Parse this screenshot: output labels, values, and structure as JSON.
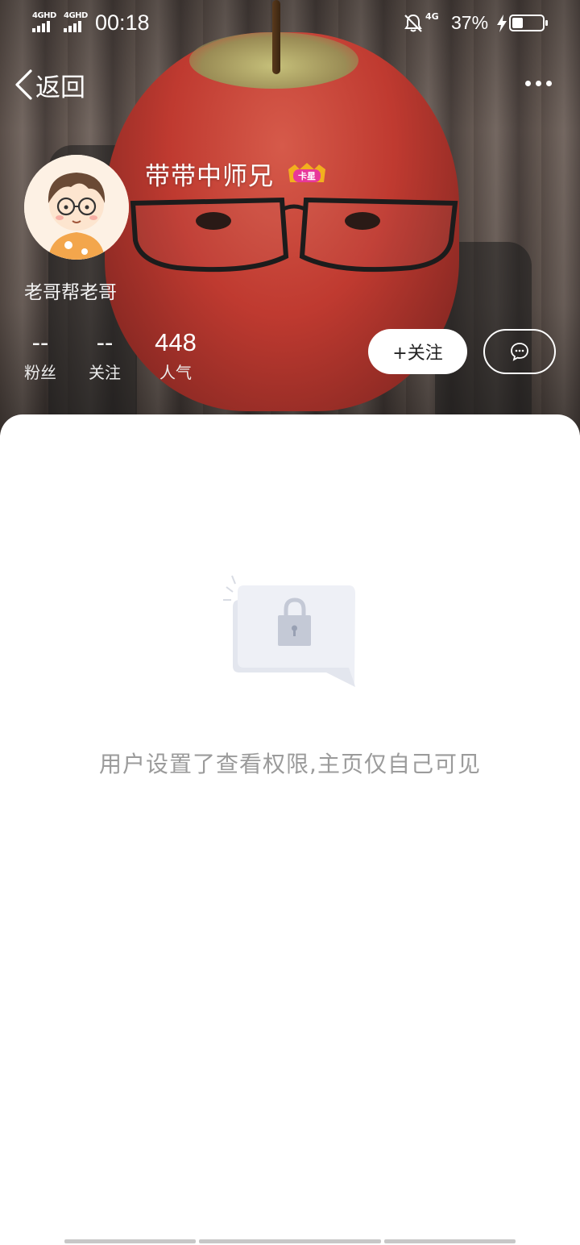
{
  "status_bar": {
    "signal1_label": "4GHD",
    "signal2_label": "4GHD",
    "time": "00:18",
    "network2_label": "4G",
    "battery_percent": "37%",
    "battery_level": 0.37,
    "charging": true
  },
  "nav": {
    "back_label": "返回",
    "more_icon": "more-horizontal-icon"
  },
  "profile": {
    "username": "带带中师兄",
    "badge_text": "卡星",
    "signature": "老哥帮老哥",
    "stats": [
      {
        "value": "--",
        "label": "粉丝"
      },
      {
        "value": "--",
        "label": "关注"
      },
      {
        "value": "448",
        "label": "人气"
      }
    ],
    "follow_button": "+关注",
    "chat_icon": "chat-bubble-icon"
  },
  "content": {
    "private_message": "用户设置了查看权限,主页仅自己可见",
    "illustration_icon": "lock-icon"
  },
  "colors": {
    "sheet_bg": "#ffffff",
    "message_text": "#9b9b9b",
    "badge_pink": "#e8389a",
    "badge_gold": "#f2b01e"
  }
}
